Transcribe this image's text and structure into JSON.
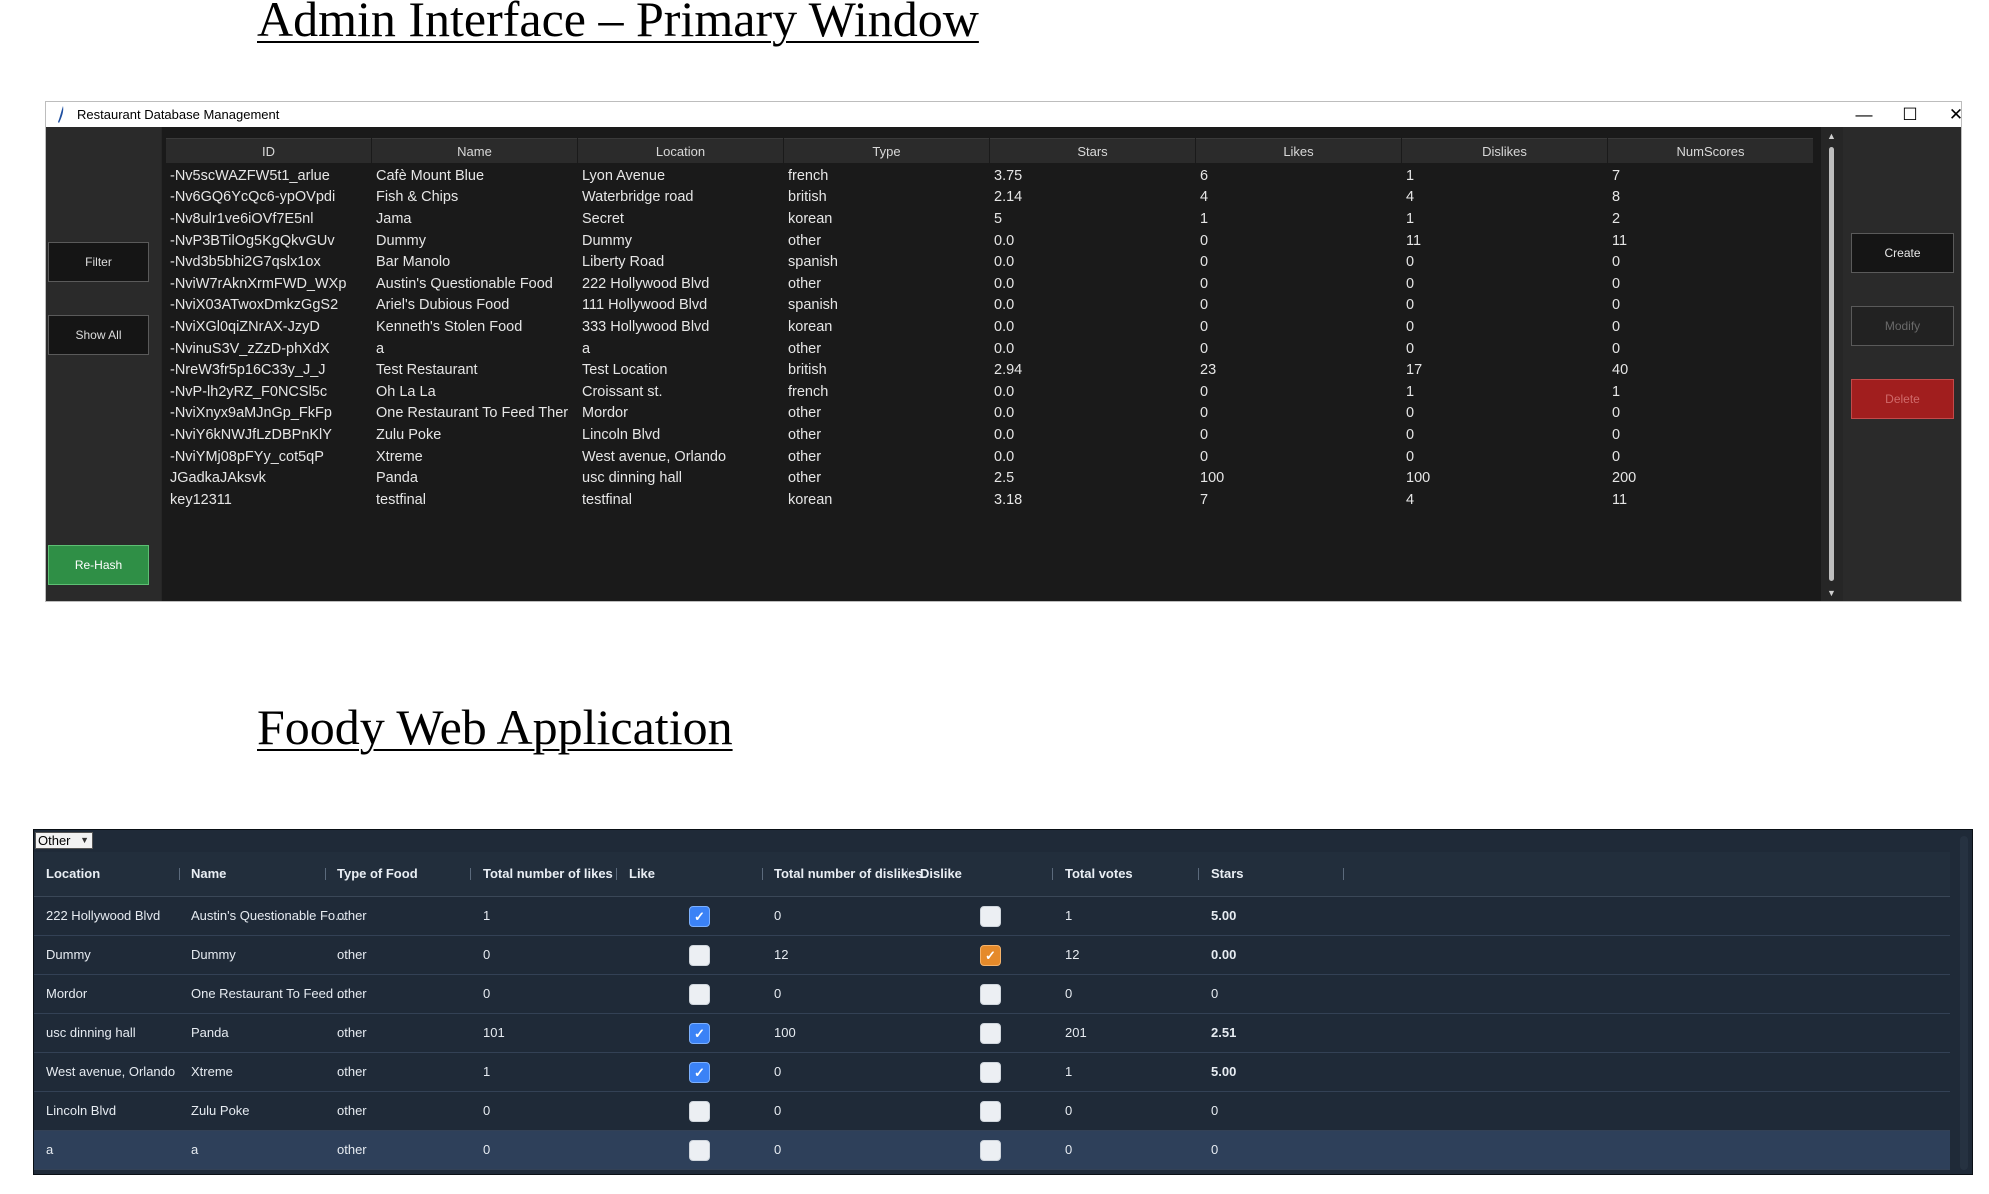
{
  "headings": {
    "admin": "Admin Interface – Primary Window",
    "foody": "Foody Web Application"
  },
  "admin": {
    "window_title": "Restaurant Database Management",
    "controls": {
      "minimize": "—",
      "maximize": "☐",
      "close": "✕"
    },
    "left_buttons": {
      "filter": "Filter",
      "show_all": "Show All",
      "rehash": "Re-Hash"
    },
    "right_buttons": {
      "create": "Create",
      "modify": "Modify",
      "delete": "Delete"
    },
    "columns": [
      "ID",
      "Name",
      "Location",
      "Type",
      "Stars",
      "Likes",
      "Dislikes",
      "NumScores"
    ],
    "rows": [
      [
        "-Nv5scWAZFW5t1_arlue",
        "Cafè Mount Blue",
        "Lyon Avenue",
        "french",
        "3.75",
        "6",
        "1",
        "7"
      ],
      [
        "-Nv6GQ6YcQc6-ypOVpdi",
        "Fish & Chips",
        "Waterbridge road",
        "british",
        "2.14",
        "4",
        "4",
        "8"
      ],
      [
        "-Nv8ulr1ve6iOVf7E5nl",
        "Jama",
        "Secret",
        "korean",
        "5",
        "1",
        "1",
        "2"
      ],
      [
        "-NvP3BTilOg5KgQkvGUv",
        "Dummy",
        "Dummy",
        "other",
        "0.0",
        "0",
        "11",
        "11"
      ],
      [
        "-Nvd3b5bhi2G7qslx1ox",
        "Bar Manolo",
        "Liberty Road",
        "spanish",
        "0.0",
        "0",
        "0",
        "0"
      ],
      [
        "-NviW7rAknXrmFWD_WXp",
        "Austin's Questionable Food",
        "222 Hollywood Blvd",
        "other",
        "0.0",
        "0",
        "0",
        "0"
      ],
      [
        "-NviX03ATwoxDmkzGgS2",
        "Ariel's Dubious Food",
        "111 Hollywood Blvd",
        "spanish",
        "0.0",
        "0",
        "0",
        "0"
      ],
      [
        "-NviXGl0qiZNrAX-JzyD",
        "Kenneth's Stolen Food",
        "333 Hollywood Blvd",
        "korean",
        "0.0",
        "0",
        "0",
        "0"
      ],
      [
        "-NvinuS3V_zZzD-phXdX",
        "a",
        "a",
        "other",
        "0.0",
        "0",
        "0",
        "0"
      ],
      [
        "-NreW3fr5p16C33y_J_J",
        "Test Restaurant",
        "Test Location",
        "british",
        "2.94",
        "23",
        "17",
        "40"
      ],
      [
        "-NvP-lh2yRZ_F0NCSl5c",
        "Oh La La",
        "Croissant st.",
        "french",
        "0.0",
        "0",
        "1",
        "1"
      ],
      [
        "-NviXnyx9aMJnGp_FkFp",
        "One Restaurant To Feed Ther",
        "Mordor",
        "other",
        "0.0",
        "0",
        "0",
        "0"
      ],
      [
        "-NviY6kNWJfLzDBPnKlY",
        "Zulu Poke",
        "Lincoln Blvd",
        "other",
        "0.0",
        "0",
        "0",
        "0"
      ],
      [
        "-NviYMj08pFYy_cot5qP",
        "Xtreme",
        "West avenue, Orlando",
        "other",
        "0.0",
        "0",
        "0",
        "0"
      ],
      [
        "JGadkaJAksvk",
        "Panda",
        "usc dinning hall",
        "other",
        "2.5",
        "100",
        "100",
        "200"
      ],
      [
        "key12311",
        "testfinal",
        "testfinal",
        "korean",
        "3.18",
        "7",
        "4",
        "11"
      ]
    ]
  },
  "foody": {
    "filter_value": "Other",
    "columns": [
      "Location",
      "Name",
      "Type of Food",
      "Total number of likes",
      "Like",
      "Total number of dislikes",
      "Dislike",
      "Total votes",
      "Stars"
    ],
    "rows": [
      {
        "location": "222 Hollywood Blvd",
        "name": "Austin's Questionable Fo...",
        "type": "other",
        "likes": "1",
        "like": true,
        "dislikes": "0",
        "dislike": false,
        "votes": "1",
        "stars": "5.00",
        "stars_bold": true
      },
      {
        "location": "Dummy",
        "name": "Dummy",
        "type": "other",
        "likes": "0",
        "like": false,
        "dislikes": "12",
        "dislike": true,
        "votes": "12",
        "stars": "0.00",
        "stars_bold": true
      },
      {
        "location": "Mordor",
        "name": "One Restaurant To Feed ...",
        "type": "other",
        "likes": "0",
        "like": false,
        "dislikes": "0",
        "dislike": false,
        "votes": "0",
        "stars": "0",
        "stars_bold": false
      },
      {
        "location": "usc dinning hall",
        "name": "Panda",
        "type": "other",
        "likes": "101",
        "like": true,
        "dislikes": "100",
        "dislike": false,
        "votes": "201",
        "stars": "2.51",
        "stars_bold": true
      },
      {
        "location": "West avenue, Orlando",
        "name": "Xtreme",
        "type": "other",
        "likes": "1",
        "like": true,
        "dislikes": "0",
        "dislike": false,
        "votes": "1",
        "stars": "5.00",
        "stars_bold": true
      },
      {
        "location": "Lincoln Blvd",
        "name": "Zulu Poke",
        "type": "other",
        "likes": "0",
        "like": false,
        "dislikes": "0",
        "dislike": false,
        "votes": "0",
        "stars": "0",
        "stars_bold": false
      },
      {
        "location": "a",
        "name": "a",
        "type": "other",
        "likes": "0",
        "like": false,
        "dislikes": "0",
        "dislike": false,
        "votes": "0",
        "stars": "0",
        "stars_bold": false,
        "selected": true
      }
    ]
  },
  "colors": {
    "admin_bg": "#1a1a1a",
    "rehash_green": "#2f8f46",
    "delete_red": "#a11e1e",
    "foody_bg": "#1f2a38",
    "checkbox_blue": "#3b82f6",
    "checkbox_orange": "#e58a2a"
  },
  "icons": {
    "app_icon": "feather-icon",
    "checkmark": "check-icon",
    "dropdown": "caret-down-icon"
  }
}
